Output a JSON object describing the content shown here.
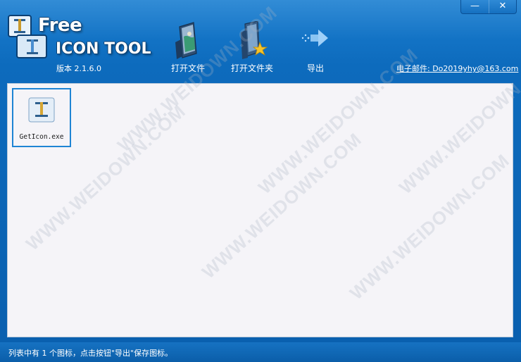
{
  "window": {
    "minimize_glyph": "—",
    "close_glyph": "✕"
  },
  "logo": {
    "free_text": "Free",
    "tool_text": "ICON TOOL"
  },
  "version_label": "版本 2.1.6.0",
  "toolbar": {
    "open_file_label": "打开文件",
    "open_folder_label": "打开文件夹",
    "export_label": "导出"
  },
  "email_label": "电子邮件: Do2019yhy@163.com",
  "files": [
    {
      "name": "GetIcon.exe",
      "icon": "app-icon"
    }
  ],
  "watermark_text": "WWW.WEIDOWN.COM",
  "status_text": "列表中有 1 个图标，点击按钮\"导出\"保存图标。",
  "colors": {
    "header_blue": "#0a66b5",
    "content_bg": "#f5f4f8",
    "selection_border": "#1e84d4"
  }
}
